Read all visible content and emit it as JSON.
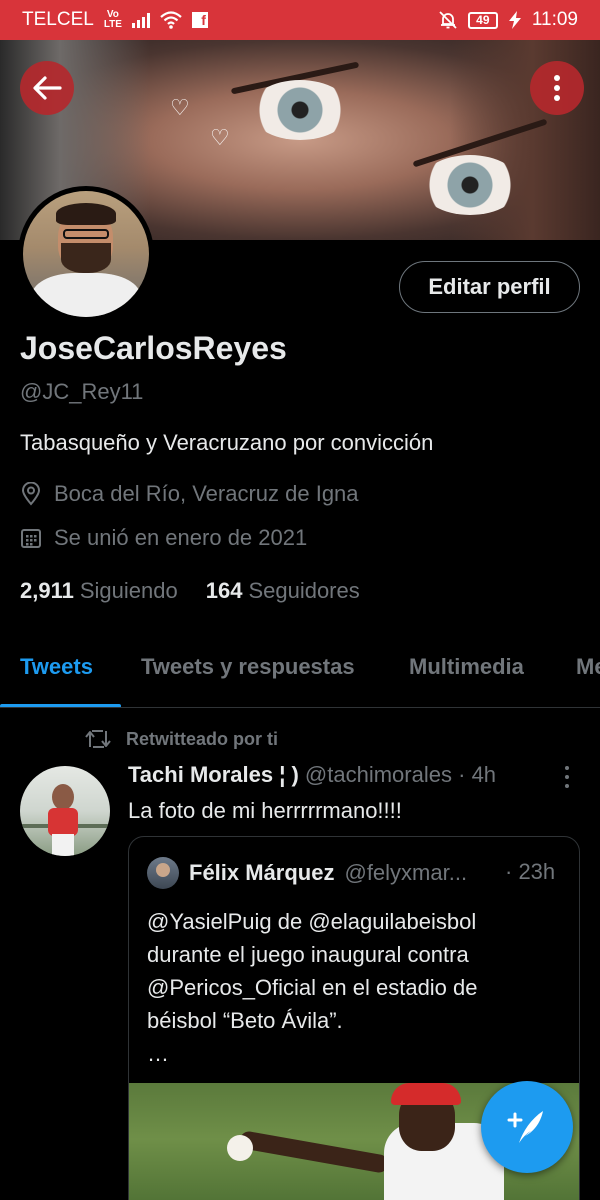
{
  "status_bar": {
    "carrier": "TELCEL",
    "network_badge_top": "Vo",
    "network_badge_bottom": "LTE",
    "battery": "49",
    "time": "11:09",
    "bar_color": "#d8343a"
  },
  "header": {
    "back_icon": "arrow-left-icon",
    "more_icon": "more-vertical-icon"
  },
  "profile": {
    "edit_button_label": "Editar perfil",
    "display_name": "JoseCarlosReyes",
    "handle": "@JC_Rey11",
    "bio": "Tabasqueño y Veracruzano por convicción",
    "location": "Boca del Río, Veracruz de Igna",
    "joined": "Se unió en enero de 2021",
    "following_count": "2,911",
    "following_label": "Siguiendo",
    "followers_count": "164",
    "followers_label": "Seguidores"
  },
  "tabs": [
    {
      "label": "Tweets",
      "active": true
    },
    {
      "label": "Tweets y respuestas",
      "active": false
    },
    {
      "label": "Multimedia",
      "active": false
    },
    {
      "label": "Me",
      "active": false
    }
  ],
  "feed": {
    "retweet_label": "Retwitteado por ti",
    "tweet": {
      "display_name": "Tachi Morales ¦ )",
      "handle": "@tachimorales",
      "separator": "·",
      "time": "4h",
      "text": "La foto de mi herrrrrmano!!!!",
      "quote": {
        "display_name": "Félix Márquez",
        "handle": "@felyxmar...",
        "time": "· 23h",
        "text_lines": [
          "@YasielPuig de @elaguilabeisbol",
          "durante el juego inaugural contra",
          "@Pericos_Oficial en el estadio de",
          "béisbol “Beto Ávila”.",
          "…"
        ]
      }
    }
  },
  "fab": {
    "icon": "compose-tweet-icon"
  },
  "colors": {
    "accent": "#1d9bf0",
    "background": "#000000",
    "muted_text": "#71767b",
    "primary_text": "#e7e9ea"
  }
}
